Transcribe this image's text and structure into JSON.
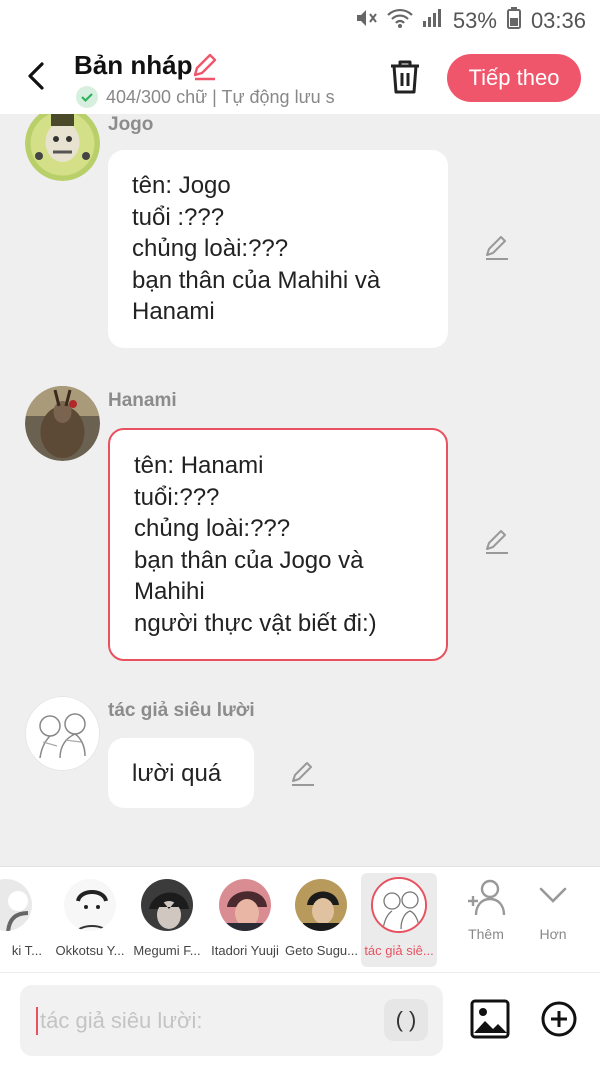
{
  "status_bar": {
    "battery": "53%",
    "time": "03:36"
  },
  "header": {
    "title": "Bản nháp",
    "status": "404/300 chữ | Tự động lưu s",
    "next_label": "Tiếp theo"
  },
  "colors": {
    "accent": "#f0566b",
    "selected_border": "#e8515f",
    "background": "#efefef"
  },
  "messages": [
    {
      "sender": "Jogo",
      "lines": [
        "tên: Jogo",
        "tuổi :???",
        "chủng loài:???",
        "bạn thân của Mahihi và",
        "Hanami"
      ]
    },
    {
      "sender": "Hanami",
      "lines": [
        "tên: Hanami",
        "tuổi:???",
        "chủng loài:???",
        "bạn thân của Jogo và",
        "Mahihi",
        "người thực vật biết đi:)"
      ]
    },
    {
      "sender": "tác giả siêu lười",
      "lines": [
        "lười quá"
      ]
    }
  ],
  "characters": [
    {
      "label": "ki T..."
    },
    {
      "label": "Okkotsu Y..."
    },
    {
      "label": "Megumi F..."
    },
    {
      "label": "Itadori Yuuji"
    },
    {
      "label": "Geto Sugu..."
    },
    {
      "label": "tác giả siê..."
    }
  ],
  "tools": {
    "add_label": "Thêm",
    "more_label": "Hơn"
  },
  "input": {
    "placeholder": "tác giả siêu lười:",
    "paren_label": "( )"
  }
}
